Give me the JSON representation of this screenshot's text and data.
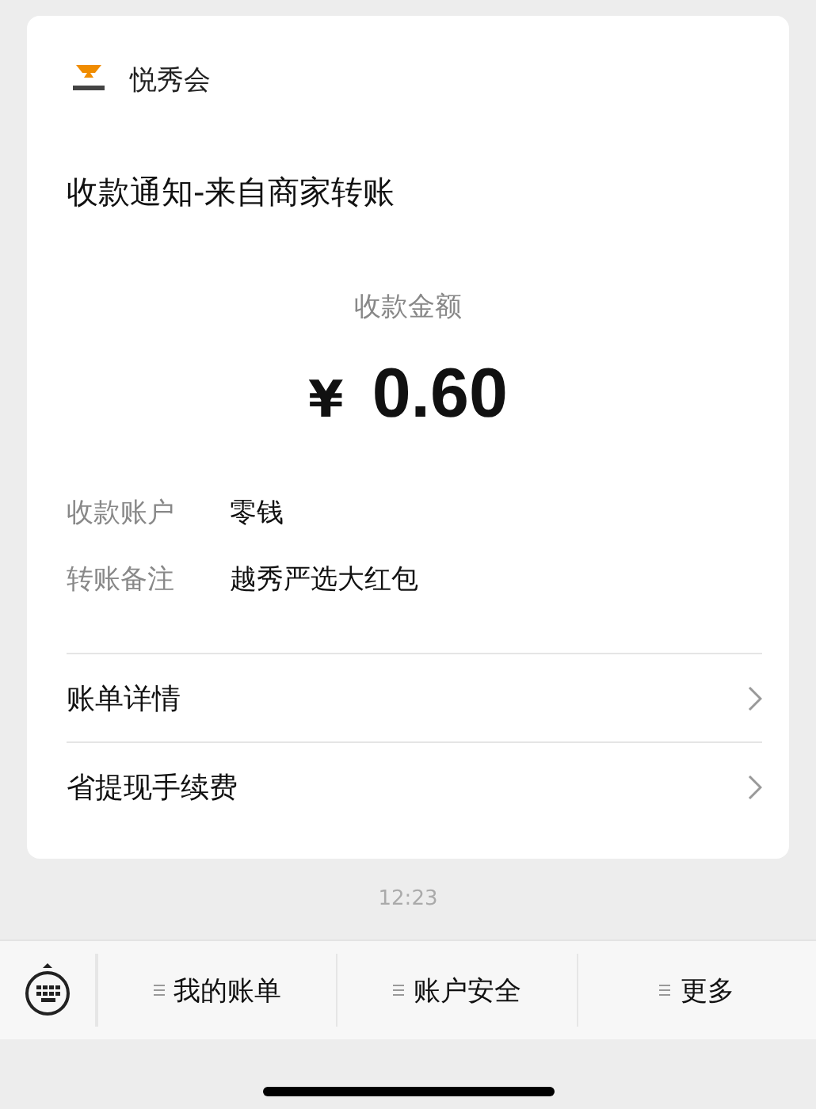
{
  "account": {
    "name": "悦秀会"
  },
  "message": {
    "title": "收款通知-来自商家转账",
    "amount_label": "收款金额",
    "currency": "¥",
    "amount": "0.60",
    "fields": [
      {
        "label": "收款账户",
        "value": "零钱"
      },
      {
        "label": "转账备注",
        "value": "越秀严选大红包"
      }
    ],
    "links": [
      {
        "label": "账单详情"
      },
      {
        "label": "省提现手续费"
      }
    ]
  },
  "time": "12:23",
  "menu": [
    {
      "label": "我的账单"
    },
    {
      "label": "账户安全"
    },
    {
      "label": "更多"
    }
  ]
}
